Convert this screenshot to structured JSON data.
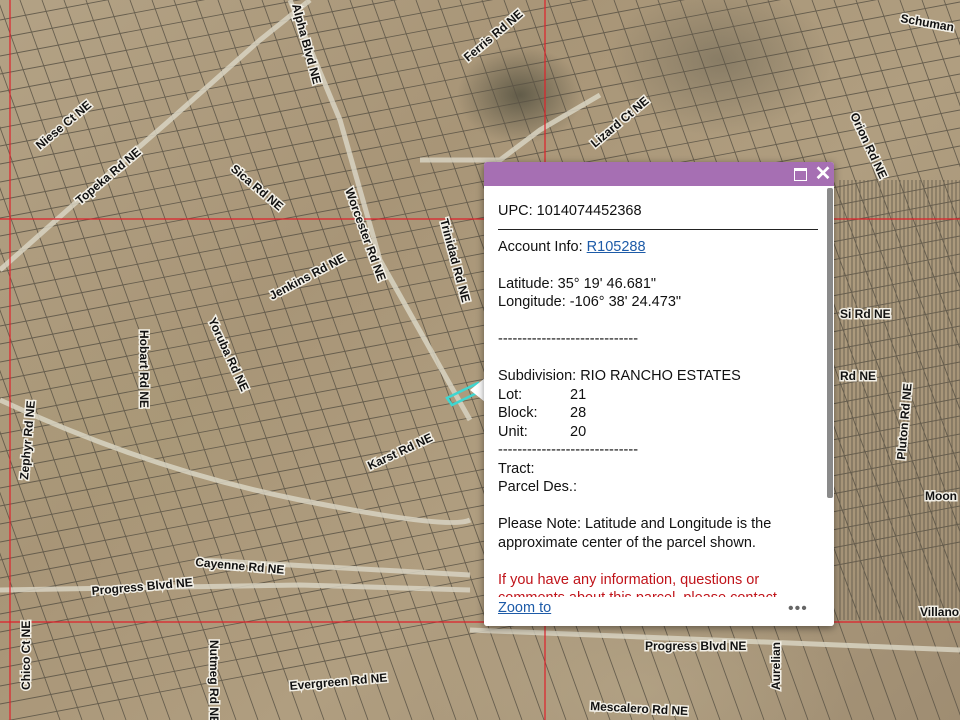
{
  "map": {
    "road_labels": [
      "Niese Ct NE",
      "Topeka Rd NE",
      "Sica Rd NE",
      "Alpha Blvd NE",
      "Ferris Rd NE",
      "Lizard Ct NE",
      "Orion Rd NE",
      "Schuman",
      "Jenkins Rd NE",
      "Worcester Rd NE",
      "Trinidad Rd NE",
      "Yoruba Rd NE",
      "Hobart Rd NE",
      "Zephyr Rd NE",
      "Karst Rd NE",
      "Cayenne Rd NE",
      "Progress Blvd NE",
      "Progress Blvd NE",
      "Nutmeg Rd NE",
      "Evergreen Rd NE",
      "Mescalero Rd NE",
      "Pluton Rd NE",
      "Moon",
      "Villano",
      "Aurelian",
      "Chico Ct NE",
      "Si Rd NE",
      "Rd NE"
    ],
    "parcel_outline_color": "#3fd6d0",
    "boundary_color": "#e0202a"
  },
  "popup": {
    "header_color": "#a66fb3",
    "maximize_icon": "maximize-icon",
    "close_icon": "close-icon",
    "close_glyph": "✕",
    "upc": "UPC: 1014074452368",
    "account_label": "Account Info: ",
    "account_link": "R105288",
    "latitude": "Latitude: 35° 19' 46.681\"",
    "longitude": "Longitude: -106° 38' 24.473\"",
    "divider": "-----------------------------",
    "subdivision": "Subdivision: RIO RANCHO ESTATES",
    "lot_label": "Lot:",
    "lot_value": "21",
    "block_label": "Block:",
    "block_value": "28",
    "unit_label": "Unit:",
    "unit_value": "20",
    "tract_label": "Tract:",
    "parcel_des_label": "Parcel Des.:",
    "note": "Please Note: Latitude and Longitude is the approximate center of the parcel shown.",
    "red_note": "If you have any information, questions or comments about this parcel, please contact",
    "zoom_to": "Zoom to",
    "more_icon": "more-options-icon",
    "more_glyph": "•••"
  }
}
